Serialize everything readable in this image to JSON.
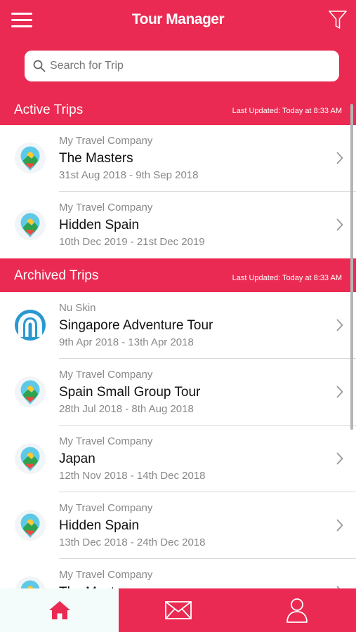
{
  "header": {
    "title": "Tour Manager",
    "menu_icon": "hamburger-menu-icon",
    "filter_icon": "filter-funnel-icon",
    "background_color": "#ea2a52"
  },
  "search": {
    "placeholder": "Search for Trip",
    "value": "",
    "icon": "search-icon"
  },
  "active_section": {
    "label": "Active Trips",
    "updated": "Last Updated: Today at 8:33 AM",
    "trips": [
      {
        "company": "My Travel Company",
        "name": "The Masters",
        "dates": "31st Aug 2018 - 9th Sep 2018",
        "logo": "travel-company-pin-logo"
      },
      {
        "company": "My Travel Company",
        "name": "Hidden Spain",
        "dates": "10th Dec 2019 - 21st Dec 2019",
        "logo": "travel-company-pin-logo"
      }
    ]
  },
  "archived_section": {
    "label": "Archived Trips",
    "updated": "Last Updated: Today at 8:33 AM",
    "trips": [
      {
        "company": "Nu Skin",
        "name": "Singapore Adventure Tour",
        "dates": "9th Apr 2018 - 13th Apr 2018",
        "logo": "nu-skin-logo"
      },
      {
        "company": "My Travel Company",
        "name": "Spain Small Group Tour",
        "dates": "28th Jul 2018 - 8th Aug 2018",
        "logo": "travel-company-pin-logo"
      },
      {
        "company": "My Travel Company",
        "name": "Japan",
        "dates": "12th Nov 2018 - 14th Dec 2018",
        "logo": "travel-company-pin-logo"
      },
      {
        "company": "My Travel Company",
        "name": "Hidden Spain",
        "dates": "13th Dec 2018 - 24th Dec 2018",
        "logo": "travel-company-pin-logo"
      },
      {
        "company": "My Travel Company",
        "name": "The Masters",
        "dates": "",
        "logo": "travel-company-pin-logo"
      }
    ]
  },
  "tabbar": {
    "tabs": [
      {
        "icon": "home-icon",
        "active": true
      },
      {
        "icon": "mail-icon",
        "active": false
      },
      {
        "icon": "profile-icon",
        "active": false
      }
    ]
  }
}
